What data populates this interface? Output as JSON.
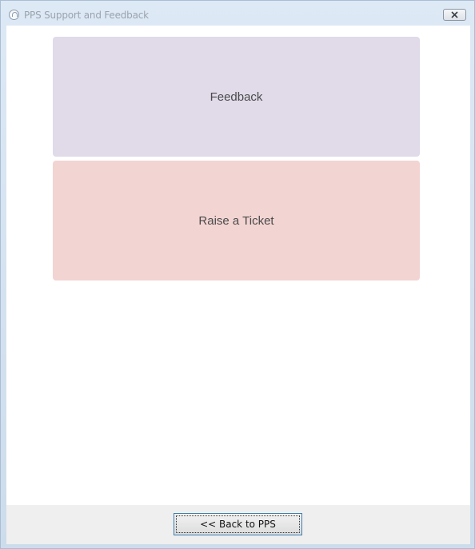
{
  "window": {
    "title": "PPS Support and Feedback",
    "close_icon": "close-icon"
  },
  "main": {
    "feedback_label": "Feedback",
    "ticket_label": "Raise a Ticket",
    "colors": {
      "feedback_bg": "#e0dae9",
      "ticket_bg": "#f2d4d2"
    }
  },
  "footer": {
    "back_label": "<< Back to PPS"
  }
}
